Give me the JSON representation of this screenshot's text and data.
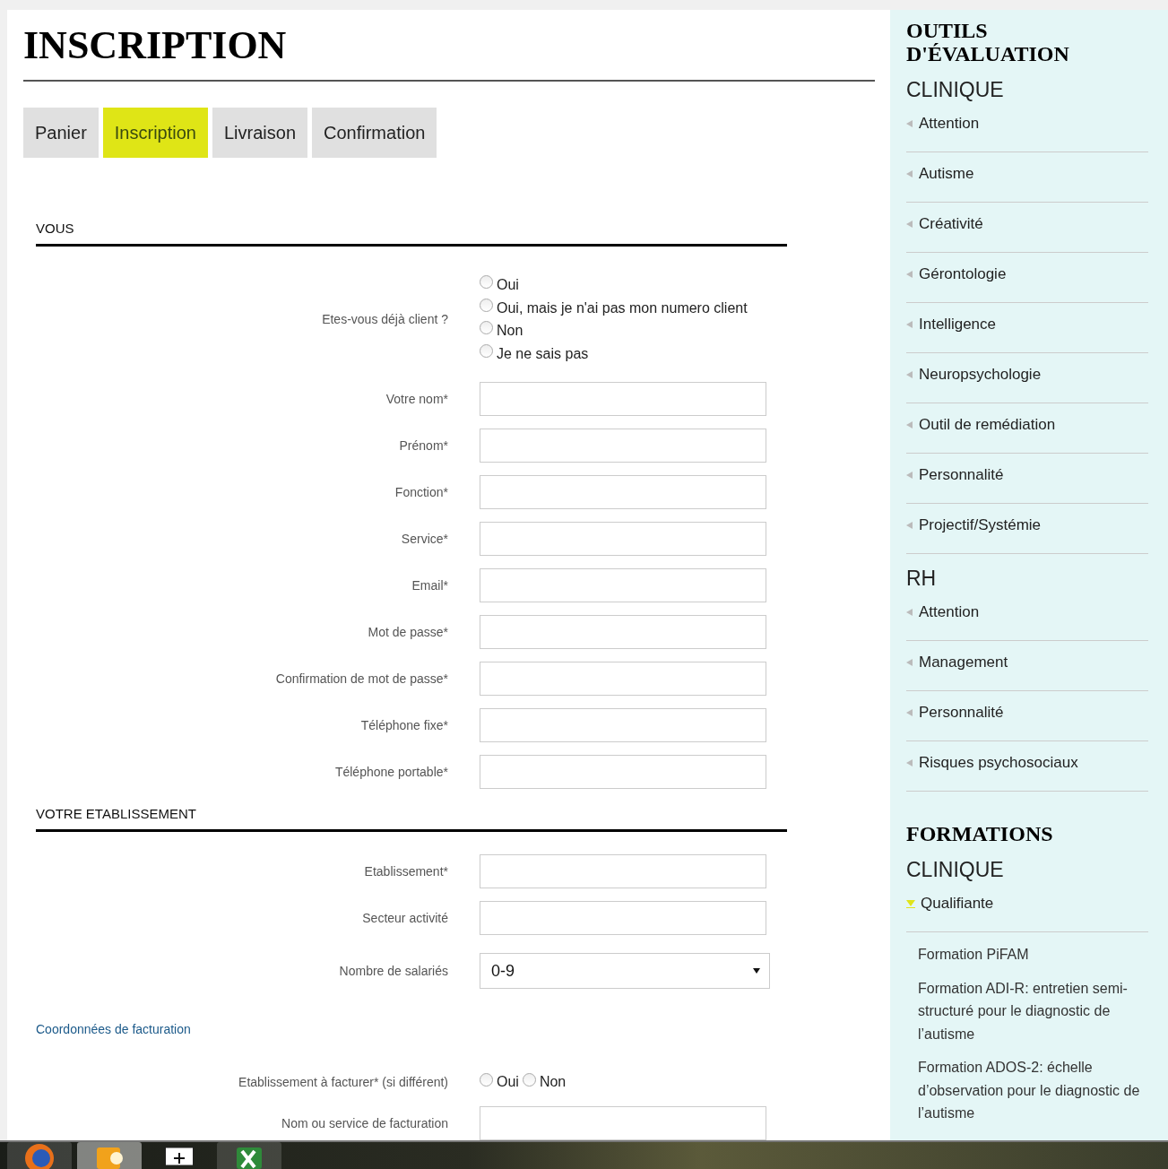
{
  "title": "INSCRIPTION",
  "steps": [
    {
      "label": "Panier",
      "selected": false
    },
    {
      "label": "Inscription",
      "selected": true
    },
    {
      "label": "Livraison",
      "selected": false
    },
    {
      "label": "Confirmation",
      "selected": false
    }
  ],
  "form": [
    {
      "kind": "section",
      "title": "VOUS"
    },
    {
      "kind": "radio-list",
      "label": "Etes-vous déjà client ?",
      "options": [
        {
          "label": "Oui",
          "selected": false
        },
        {
          "label": "Oui, mais je n'ai pas mon numero client",
          "selected": false
        },
        {
          "label": "Non",
          "selected": false
        },
        {
          "label": "Je ne sais pas",
          "selected": false
        }
      ]
    },
    {
      "kind": "text",
      "label": "Votre nom*"
    },
    {
      "kind": "text",
      "label": "Prénom*"
    },
    {
      "kind": "text",
      "label": "Fonction*"
    },
    {
      "kind": "text",
      "label": "Service*"
    },
    {
      "kind": "text",
      "label": "Email*"
    },
    {
      "kind": "text",
      "label": "Mot de passe*"
    },
    {
      "kind": "text",
      "label": "Confirmation de mot de passe*"
    },
    {
      "kind": "text",
      "label": "Téléphone fixe*"
    },
    {
      "kind": "text",
      "label": "Téléphone portable*"
    },
    {
      "kind": "section",
      "title": "VOTRE ETABLISSEMENT"
    },
    {
      "kind": "text",
      "label": "Etablissement*"
    },
    {
      "kind": "text",
      "label": "Secteur activité"
    },
    {
      "kind": "select",
      "label": "Nombre de salariés",
      "value": "0-9"
    },
    {
      "kind": "link",
      "label": "Coordonnées de facturation"
    },
    {
      "kind": "radio-inline",
      "label": "Etablissement à facturer* (si différent)",
      "options": [
        {
          "label": "Oui",
          "selected": false
        },
        {
          "label": "Non",
          "selected": false
        }
      ]
    },
    {
      "kind": "text",
      "label": "Nom ou service de facturation"
    }
  ],
  "sidebar": [
    {
      "heading": "OUTILS D'ÉVALUATION",
      "groups": [
        {
          "title": "CLINIQUE",
          "items": [
            {
              "label": "Attention",
              "expanded": false
            },
            {
              "label": "Autisme",
              "expanded": false
            },
            {
              "label": "Créativité",
              "expanded": false
            },
            {
              "label": "Gérontologie",
              "expanded": false
            },
            {
              "label": "Intelligence",
              "expanded": false
            },
            {
              "label": "Neuropsychologie",
              "expanded": false
            },
            {
              "label": "Outil de remédiation",
              "expanded": false
            },
            {
              "label": "Personnalité",
              "expanded": false
            },
            {
              "label": "Projectif/Systémie",
              "expanded": false
            }
          ]
        },
        {
          "title": "RH",
          "items": [
            {
              "label": "Attention",
              "expanded": false
            },
            {
              "label": "Management",
              "expanded": false
            },
            {
              "label": "Personnalité",
              "expanded": false
            },
            {
              "label": "Risques psychosociaux",
              "expanded": false
            }
          ]
        }
      ]
    },
    {
      "heading": "FORMATIONS",
      "groups": [
        {
          "title": "CLINIQUE",
          "items": [
            {
              "label": "Qualifiante",
              "expanded": true,
              "children": [
                {
                  "label": "Formation PiFAM"
                },
                {
                  "label": "Formation ADI-R: entretien semi-structuré pour le diagnostic de l’autisme"
                },
                {
                  "label": "Formation ADOS-2: échelle d’observation pour le diagnostic de l’autisme"
                }
              ]
            }
          ]
        }
      ]
    }
  ]
}
